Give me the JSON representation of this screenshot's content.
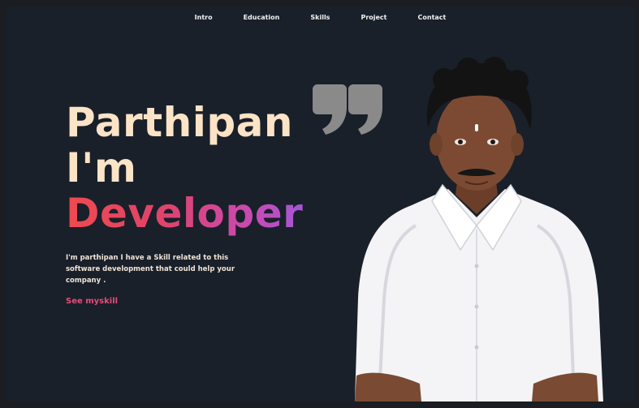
{
  "nav": {
    "items": [
      "Intro",
      "Education",
      "Skills",
      "Project",
      "Contact"
    ]
  },
  "hero": {
    "name": "Parthipan",
    "im": "I'm",
    "role": "Developer",
    "description": "I'm parthipan I have a Skill related to this software development that could help your company .",
    "cta": "See myskill",
    "quote_icon": "quote-icon",
    "photo_icon": "profile-photo"
  },
  "colors": {
    "background": "#19202a",
    "name_color": "#fbe3c6",
    "gradient_start": "#f04a4f",
    "gradient_end": "#a456d6",
    "cta_color": "#e84b7a",
    "shirt": "#f4f4f6"
  }
}
